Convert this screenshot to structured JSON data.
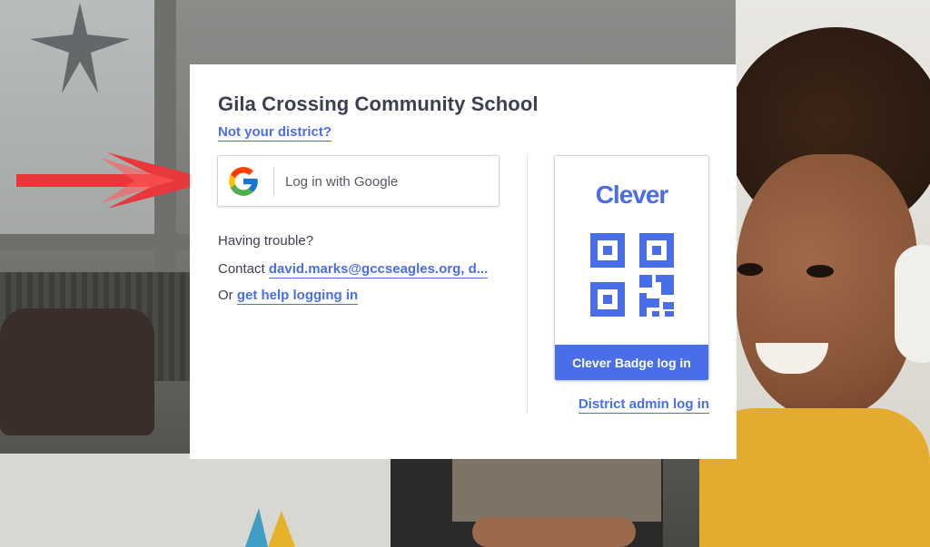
{
  "login": {
    "district_name": "Gila Crossing Community School",
    "not_your_district": "Not your district?",
    "google_button_label": "Log in with Google",
    "having_trouble": "Having trouble?",
    "contact_prefix": "Contact",
    "contact_email": "david.marks@gccseagles.org, d...",
    "or_prefix": "Or",
    "help_link": "get help logging in"
  },
  "badge": {
    "logo_text": "Clever",
    "button_label": "Clever Badge log in"
  },
  "admin_link": "District admin log in",
  "colors": {
    "accent": "#4a6ee8",
    "arrow": "#e8383b",
    "text": "#3c3f52"
  },
  "icons": [
    "google-logo-icon",
    "qr-code-icon",
    "red-arrow-annotation"
  ]
}
